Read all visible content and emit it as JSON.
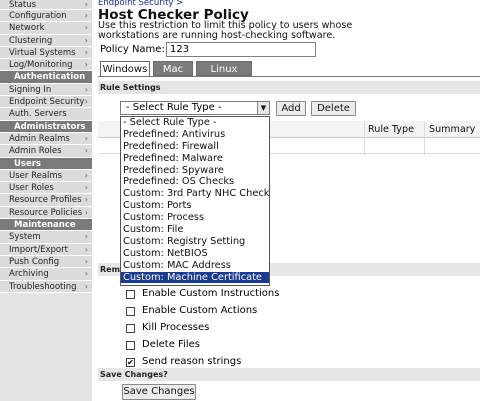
{
  "sidebar": {
    "items_top": [
      {
        "label": "Status"
      },
      {
        "label": "Configuration"
      },
      {
        "label": "Network"
      },
      {
        "label": "Clustering"
      },
      {
        "label": "Virtual Systems"
      },
      {
        "label": "Log/Monitoring"
      }
    ],
    "head_auth": "Authentication",
    "items_auth": [
      {
        "label": "Signing In"
      },
      {
        "label": "Endpoint Security"
      },
      {
        "label": "Auth. Servers"
      }
    ],
    "head_admin": "Administrators",
    "items_admin": [
      {
        "label": "Admin Realms"
      },
      {
        "label": "Admin Roles"
      }
    ],
    "head_users": "Users",
    "items_users": [
      {
        "label": "User Realms"
      },
      {
        "label": "User Roles"
      },
      {
        "label": "Resource Profiles"
      },
      {
        "label": "Resource Policies"
      }
    ],
    "head_maint": "Maintenance",
    "items_maint": [
      {
        "label": "System"
      },
      {
        "label": "Import/Export"
      },
      {
        "label": "Push Config"
      },
      {
        "label": "Archiving"
      },
      {
        "label": "Troubleshooting"
      }
    ]
  },
  "main": {
    "breadcrumb": "Endpoint Security",
    "breadcrumb_sep": ">",
    "title": "Host Checker Policy",
    "description": "Use this restriction to limit this policy to users whose workstations are running host-checking software.",
    "policy_name_label": "Policy Name:",
    "policy_name_value": "123",
    "tabs": [
      {
        "label": "Windows"
      },
      {
        "label": "Mac"
      },
      {
        "label": "Linux"
      }
    ],
    "rule_settings_head": "Rule Settings",
    "select_value": "- Select Rule Type -",
    "add_label": "Add",
    "delete_label": "Delete",
    "col_rule_type": "Rule Type",
    "col_summary": "Summary",
    "dropdown_options": [
      "- Select Rule Type -",
      "Predefined: Antivirus",
      "Predefined: Firewall",
      "Predefined: Malware",
      "Predefined: Spyware",
      "Predefined: OS Checks",
      "Custom: 3rd Party NHC Check",
      "Custom: Ports",
      "Custom: Process",
      "Custom: File",
      "Custom: Registry Setting",
      "Custom: NetBIOS",
      "Custom: MAC Address",
      "Custom: Machine Certificate"
    ],
    "remediation_head": "Reme",
    "checkboxes": [
      {
        "label": "Enable Custom Instructions",
        "checked": false
      },
      {
        "label": "Enable Custom Actions",
        "checked": false
      },
      {
        "label": "Kill Processes",
        "checked": false
      },
      {
        "label": "Delete Files",
        "checked": false
      },
      {
        "label": "Send reason strings",
        "checked": true
      }
    ],
    "save_head": "Save Changes?",
    "save_label": "Save Changes"
  },
  "colors": {
    "sidebar_bg": "#dcdcdc",
    "sidebar_head": "#7a7a7a",
    "tab_inactive": "#7b7b7b",
    "highlight": "#1c3b8f",
    "link": "#1a2a7a"
  }
}
